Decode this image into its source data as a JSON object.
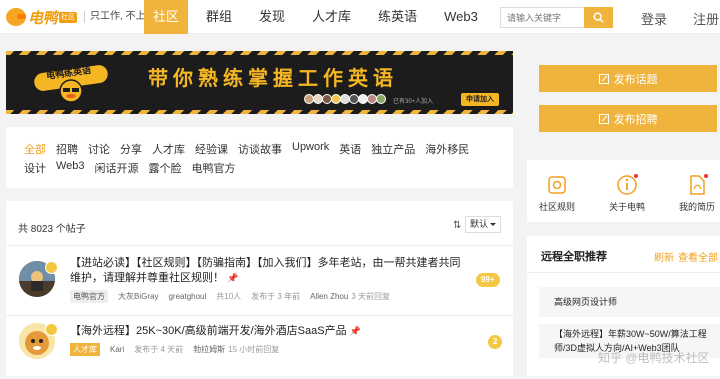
{
  "header": {
    "logo_text": "电鸭",
    "logo_badge": "社区",
    "slogan": "只工作, 不上班",
    "nav": [
      "社区",
      "群组",
      "发现",
      "人才库",
      "练英语",
      "Web3"
    ],
    "search_placeholder": "请输入关键字",
    "login": "登录",
    "register": "注册"
  },
  "banner": {
    "badge_text": "电鸭练英语",
    "title": "带你熟练掌握工作英语",
    "count_text": "已有30+人加入",
    "join_label": "申请加入"
  },
  "categories": {
    "row1": [
      "全部",
      "招聘",
      "讨论",
      "分享",
      "人才库",
      "经验课",
      "访谈故事",
      "Upwork",
      "英语",
      "独立产品",
      "海外移民"
    ],
    "row2": [
      "设计",
      "Web3",
      "闲话开源",
      "露个脸",
      "电鸭官方"
    ]
  },
  "posts": {
    "total": "共 8023 个帖子",
    "sort": "默认",
    "items": [
      {
        "title": "【进站必读】【社区规则】【防骗指南】【加入我们】多年老站，由一帮共建者共同维护，请理解并尊重社区规则！",
        "tag": "电鸭官方",
        "author": "大灰BiGray",
        "repliers": "greatghoul",
        "members": "共10人",
        "posted": "发布于 3 年前",
        "last_reply_user": "Allen Zhou",
        "last_reply": "3 天前回复",
        "count": "99+"
      },
      {
        "title": "【海外远程】25K~30K/高级前端开发/海外酒店SaaS产品",
        "tag": "人才库",
        "author": "Kari",
        "posted": "发布于 4 天前",
        "last_reply_user": "勃拉姆斯",
        "last_reply": "15 小时前回复",
        "count": "2"
      }
    ]
  },
  "sidebar": {
    "publish_topic": "发布话题",
    "publish_recruit": "发布招聘",
    "quick_links": [
      "社区规则",
      "关于电鸭",
      "我的简历"
    ],
    "jobs_title": "远程全职推荐",
    "refresh": "刷新",
    "view_all": "查看全部",
    "jobs": [
      "高级网页设计师",
      "【海外远程】年薪30W~50W/算法工程师/3D虚拟人方向/AI+Web3团队"
    ]
  },
  "watermark": "知乎 @电鸭技术社区",
  "colors": {
    "accent": "#f0b43c",
    "accent_text": "#f0a020"
  }
}
